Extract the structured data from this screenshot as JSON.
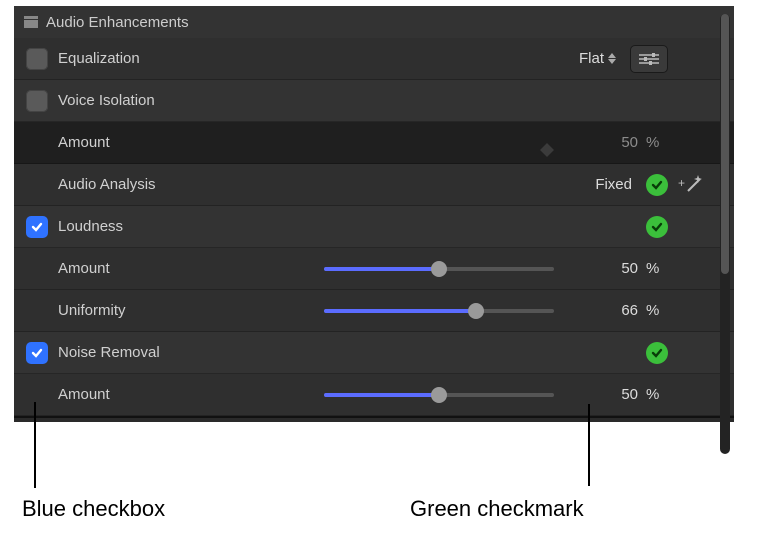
{
  "header": {
    "title": "Audio Enhancements"
  },
  "equalization": {
    "label": "Equalization",
    "preset": "Flat"
  },
  "voice_isolation": {
    "label": "Voice Isolation",
    "amount": {
      "label": "Amount",
      "value": "50",
      "unit": "%"
    }
  },
  "audio_analysis": {
    "label": "Audio Analysis",
    "status": "Fixed"
  },
  "loudness": {
    "label": "Loudness",
    "amount": {
      "label": "Amount",
      "value": "50",
      "unit": "%",
      "pct": 50
    },
    "uniformity": {
      "label": "Uniformity",
      "value": "66",
      "unit": "%",
      "pct": 66
    }
  },
  "noise_removal": {
    "label": "Noise Removal",
    "amount": {
      "label": "Amount",
      "value": "50",
      "unit": "%",
      "pct": 50
    }
  },
  "callouts": {
    "blue_checkbox": "Blue checkbox",
    "green_checkmark": "Green checkmark"
  }
}
